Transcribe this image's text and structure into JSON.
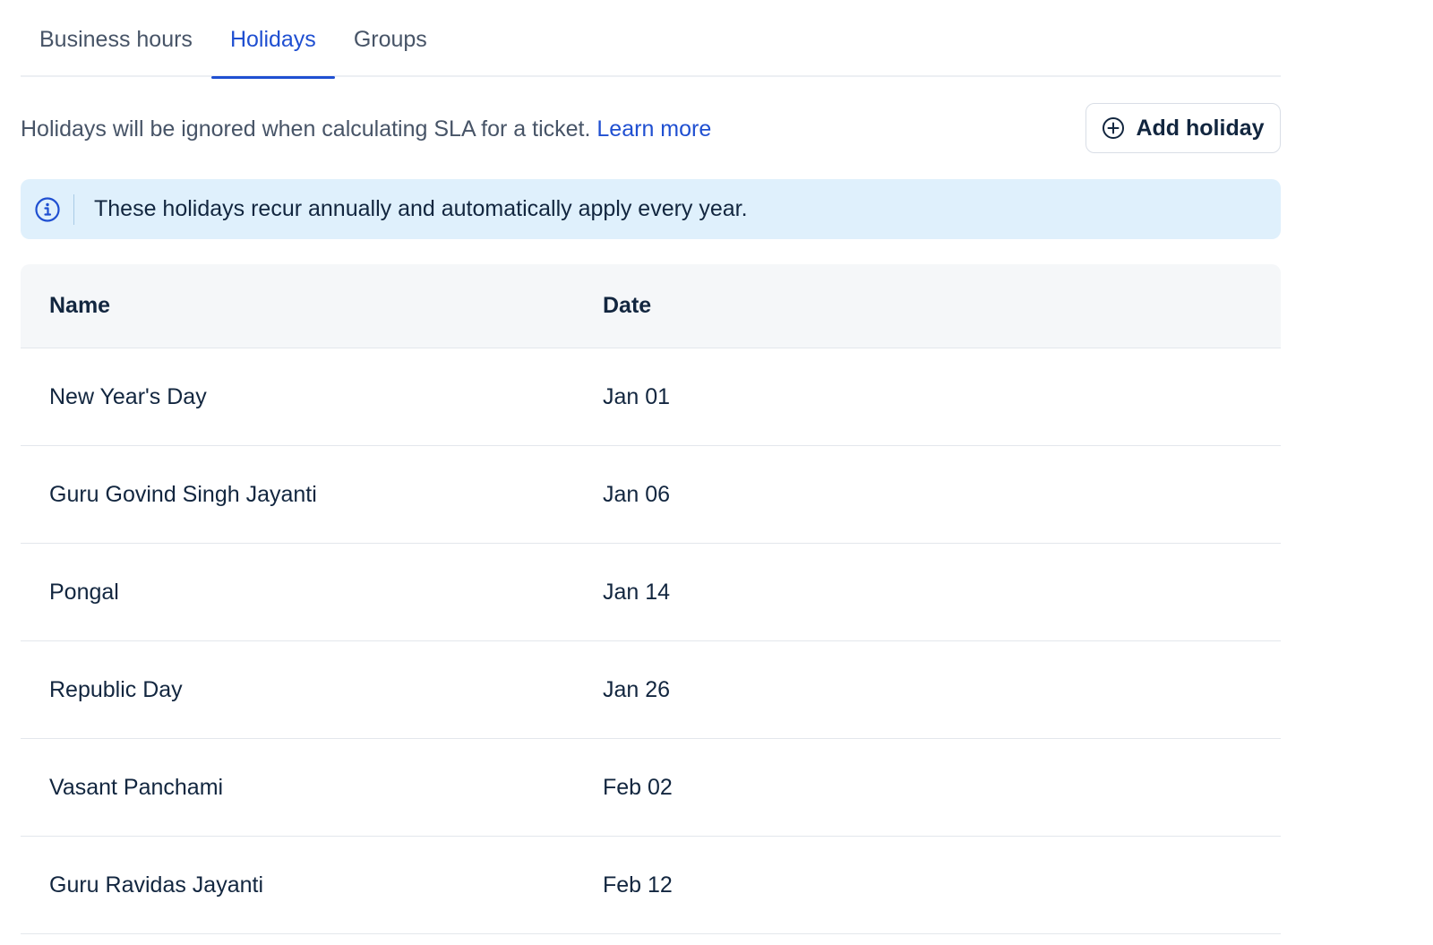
{
  "tabs": [
    {
      "label": "Business hours",
      "active": false
    },
    {
      "label": "Holidays",
      "active": true
    },
    {
      "label": "Groups",
      "active": false
    }
  ],
  "description": {
    "text": "Holidays will be ignored when calculating SLA for a ticket.",
    "link": "Learn more"
  },
  "add_button": {
    "label": "Add holiday",
    "icon": "plus-circle-icon"
  },
  "info_banner": {
    "icon": "info-icon",
    "text": "These holidays recur annually and automatically apply every year."
  },
  "table": {
    "columns": [
      "Name",
      "Date"
    ],
    "rows": [
      {
        "name": "New Year's Day",
        "date": "Jan 01"
      },
      {
        "name": "Guru Govind Singh Jayanti",
        "date": "Jan 06"
      },
      {
        "name": "Pongal",
        "date": "Jan 14"
      },
      {
        "name": "Republic Day",
        "date": "Jan 26"
      },
      {
        "name": "Vasant Panchami",
        "date": "Feb 02"
      },
      {
        "name": "Guru Ravidas Jayanti",
        "date": "Feb 12"
      }
    ]
  },
  "colors": {
    "accent": "#1f4fd1",
    "banner_bg": "#dff0fc",
    "header_bg": "#f5f7f9",
    "text": "#12263f",
    "muted_text": "#475467"
  }
}
